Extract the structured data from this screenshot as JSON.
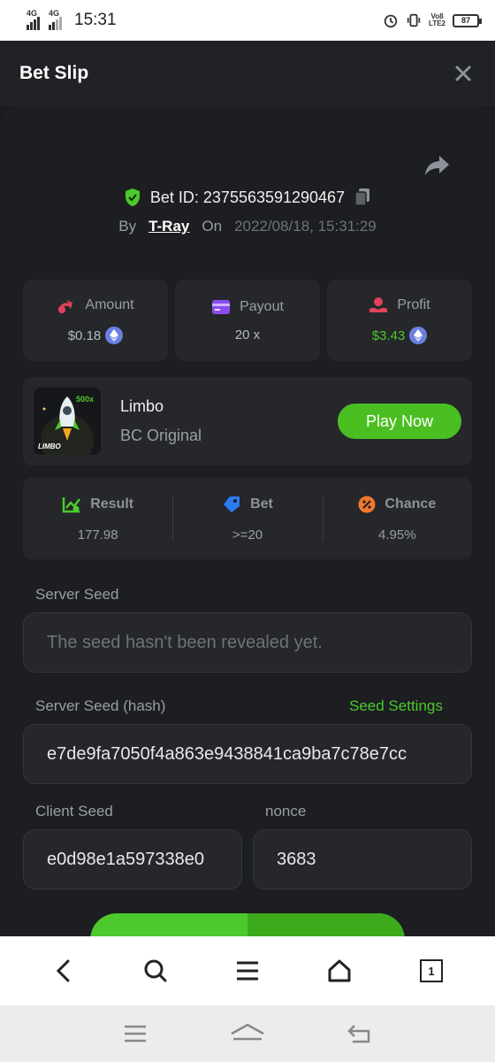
{
  "status_bar": {
    "net1": "4G",
    "net2": "4G",
    "time": "15:31",
    "volte": "Vo8\nLTE2",
    "battery": "87"
  },
  "header": {
    "title": "Bet Slip"
  },
  "bet": {
    "id_text": "Bet ID: 2375563591290467",
    "by_label": "By",
    "user": "T-Ray",
    "on_label": "On",
    "datetime": "2022/08/18, 15:31:29"
  },
  "stats": [
    {
      "label": "Amount",
      "value": "$0.18",
      "icon": "amount-icon"
    },
    {
      "label": "Payout",
      "value": "20 x",
      "icon": "wallet-icon"
    },
    {
      "label": "Profit",
      "value": "$3.43",
      "icon": "profit-icon"
    }
  ],
  "game": {
    "name": "Limbo",
    "subtitle": "BC Original",
    "play_label": "Play Now",
    "thumb_badge": "500x",
    "thumb_label": "LIMBO"
  },
  "result": [
    {
      "label": "Result",
      "value": "177.98"
    },
    {
      "label": "Bet",
      "value": ">=20"
    },
    {
      "label": "Chance",
      "value": "4.95%"
    }
  ],
  "seeds": {
    "server_seed_label": "Server Seed",
    "server_seed_value": "The seed hasn't been revealed yet.",
    "server_hash_label": "Server Seed (hash)",
    "seed_settings": "Seed Settings",
    "server_hash_value": "e7de9fa7050f4a863e9438841ca9ba7c78e7cc",
    "client_seed_label": "Client Seed",
    "client_seed_value": "e0d98e1a597338e0",
    "nonce_label": "nonce",
    "nonce_value": "3683"
  },
  "browser": {
    "tab_count": "1"
  },
  "colors": {
    "accent": "#4cc92c",
    "bg": "#1c1e21",
    "card": "#25272b"
  }
}
